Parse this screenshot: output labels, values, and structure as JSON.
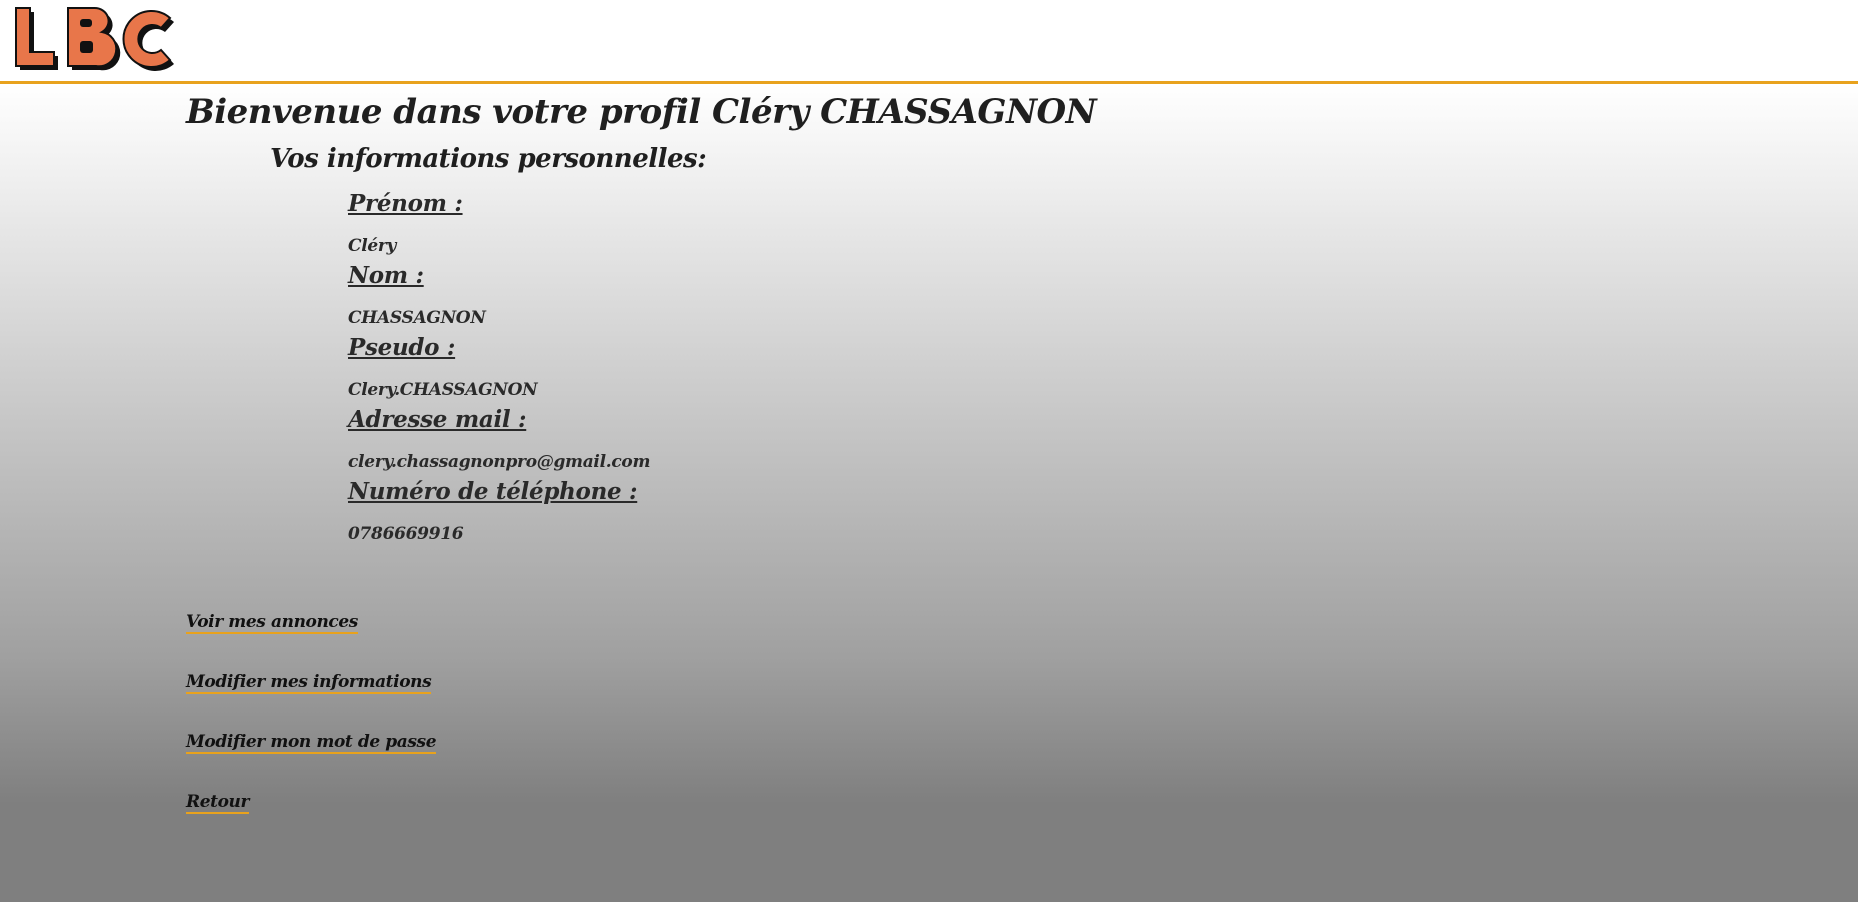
{
  "header": {
    "logo_text": "LBC",
    "logo_colors": {
      "fill": "#e8764a",
      "shadow": "#111111"
    },
    "accent_color": "#e8a21d"
  },
  "profile": {
    "title": "Bienvenue dans votre profil Cléry CHASSAGNON",
    "subtitle": "Vos informations personnelles:",
    "fields": [
      {
        "label": "Prénom :",
        "value": "Cléry"
      },
      {
        "label": "Nom :",
        "value": "CHASSAGNON"
      },
      {
        "label": "Pseudo :",
        "value": "Clery.CHASSAGNON"
      },
      {
        "label": "Adresse mail :",
        "value": "clery.chassagnonpro@gmail.com"
      },
      {
        "label": "Numéro de téléphone :",
        "value": "0786669916"
      }
    ]
  },
  "actions": [
    {
      "label": "Voir mes annonces"
    },
    {
      "label": "Modifier mes informations"
    },
    {
      "label": "Modifier mon mot de passe"
    },
    {
      "label": "Retour"
    }
  ]
}
